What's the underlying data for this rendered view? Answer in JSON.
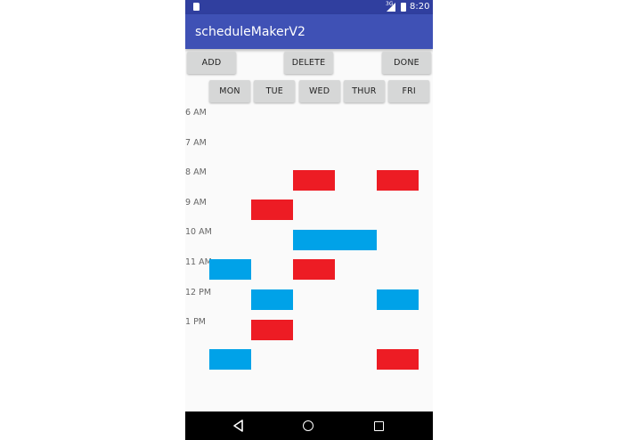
{
  "status_bar": {
    "signal_label": "3G",
    "time": "8:20"
  },
  "app_bar": {
    "title": "scheduleMakerV2"
  },
  "toolbar": {
    "add_label": "ADD",
    "delete_label": "DELETE",
    "done_label": "DONE"
  },
  "days": [
    "MON",
    "TUE",
    "WED",
    "THUR",
    "FRI"
  ],
  "time_labels": [
    "6 AM",
    "7 AM",
    "8 AM",
    "9 AM",
    "10 AM",
    "11 AM",
    "12 PM",
    "1 PM"
  ],
  "colors": {
    "status_bar": "#303f9f",
    "app_bar": "#3f51b5",
    "red_block": "#ed1c24",
    "blue_block": "#00a2e8",
    "button_bg": "#d6d7d7",
    "background": "#fafafa"
  },
  "blocks": [
    {
      "day": "WED",
      "time": "7 AM",
      "span_days": 1,
      "color": "red"
    },
    {
      "day": "FRI",
      "time": "7 AM",
      "span_days": 1,
      "color": "red"
    },
    {
      "day": "TUE",
      "time": "8 AM",
      "span_days": 1,
      "color": "red"
    },
    {
      "day": "WED",
      "time": "9 AM",
      "span_days": 2,
      "color": "blue"
    },
    {
      "day": "MON",
      "time": "10 AM",
      "span_days": 1,
      "color": "blue"
    },
    {
      "day": "WED",
      "time": "10 AM",
      "span_days": 1,
      "color": "red"
    },
    {
      "day": "TUE",
      "time": "11 AM",
      "span_days": 1,
      "color": "blue"
    },
    {
      "day": "FRI",
      "time": "11 AM",
      "span_days": 1,
      "color": "blue"
    },
    {
      "day": "TUE",
      "time": "12 PM",
      "span_days": 1,
      "color": "red"
    },
    {
      "day": "MON",
      "time": "1 PM",
      "span_days": 1,
      "color": "blue"
    },
    {
      "day": "FRI",
      "time": "1 PM",
      "span_days": 1,
      "color": "red"
    }
  ],
  "nav_bar": {
    "icons": [
      "back-icon",
      "home-icon",
      "recents-icon"
    ]
  }
}
